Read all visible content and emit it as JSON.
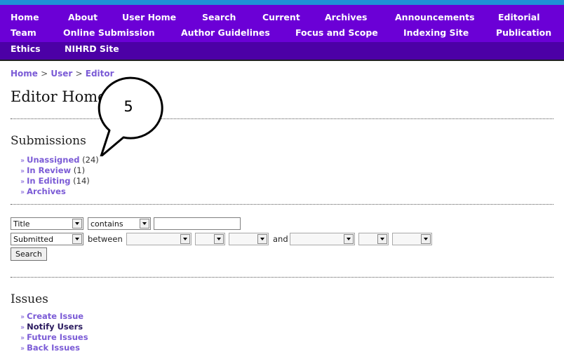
{
  "nav": {
    "items": [
      "Home",
      "About",
      "User Home",
      "Search",
      "Current",
      "Archives",
      "Announcements",
      "Editorial",
      "Team",
      "Online Submission",
      "Author Guidelines",
      "Focus and Scope",
      "Indexing Site",
      "Publication",
      "Ethics",
      "NIHRD Site"
    ]
  },
  "breadcrumb": {
    "home": "Home",
    "user": "User",
    "editor": "Editor",
    "sep": ">"
  },
  "page_title": "Editor Home",
  "callout": {
    "number": "5"
  },
  "submissions": {
    "heading": "Submissions",
    "items": [
      {
        "label": "Unassigned",
        "count": "(24)"
      },
      {
        "label": "In Review",
        "count": "(1)"
      },
      {
        "label": "In Editing",
        "count": "(14)"
      },
      {
        "label": "Archives",
        "count": ""
      }
    ]
  },
  "search_form": {
    "field_select": "Title",
    "match_select": "contains",
    "search_input_value": "",
    "date_field_select": "Submitted",
    "between_label": "between",
    "and_label": "and",
    "search_button": "Search"
  },
  "issues": {
    "heading": "Issues",
    "items": [
      "Create Issue",
      "Notify Users",
      "Future Issues",
      "Back Issues"
    ]
  },
  "bullet": "»",
  "colors": {
    "nav_bg": "#6b00d6",
    "link": "#7b5bd6",
    "top_strip": "#1f8fd6"
  }
}
